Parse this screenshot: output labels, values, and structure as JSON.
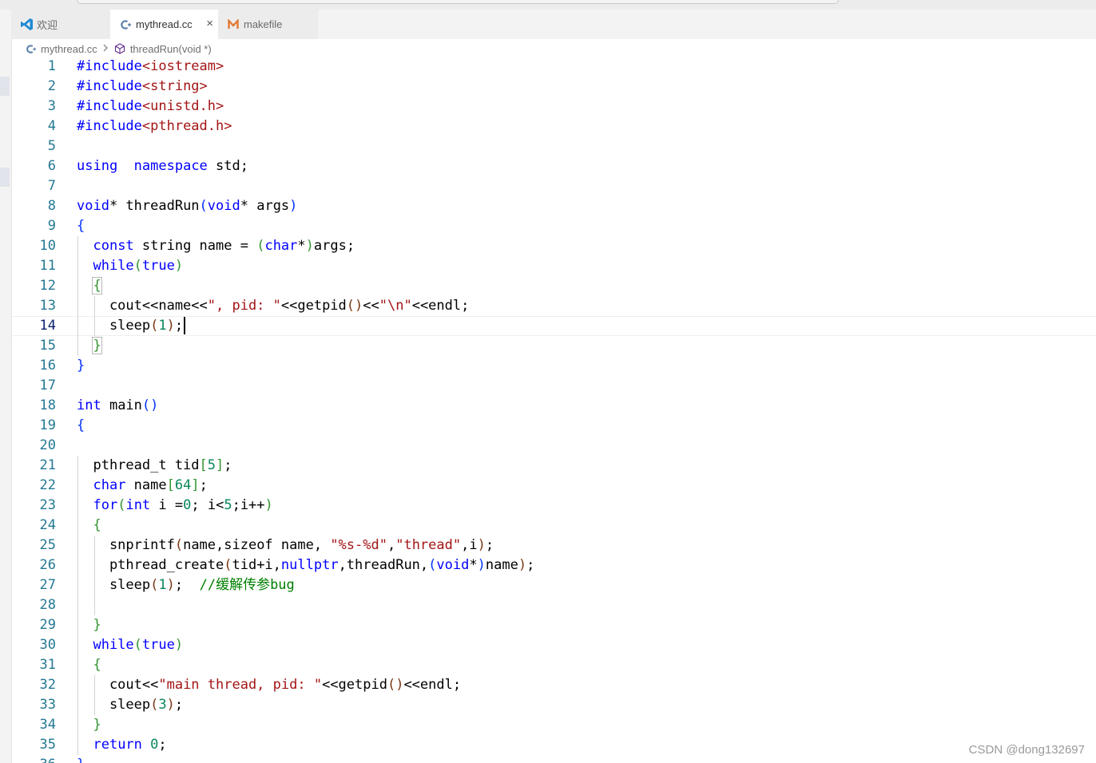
{
  "tabs": [
    {
      "label": "欢迎",
      "icon": "vscode-logo-icon"
    },
    {
      "label": "mythread.cc",
      "icon": "cpp-file-icon",
      "close_glyph": "×"
    },
    {
      "label": "makefile",
      "icon": "makefile-m-icon"
    }
  ],
  "breadcrumb": {
    "file": "mythread.cc",
    "symbol": "threadRun(void *)"
  },
  "editor": {
    "current_line": 14,
    "lines": [
      [
        [
          "pp",
          "#include"
        ],
        [
          "s",
          "<iostream>"
        ]
      ],
      [
        [
          "pp",
          "#include"
        ],
        [
          "s",
          "<string>"
        ]
      ],
      [
        [
          "pp",
          "#include"
        ],
        [
          "s",
          "<unistd.h>"
        ]
      ],
      [
        [
          "pp",
          "#include"
        ],
        [
          "s",
          "<pthread.h>"
        ]
      ],
      [],
      [
        [
          "k",
          "using"
        ],
        [
          "",
          "  "
        ],
        [
          "k",
          "namespace"
        ],
        [
          "",
          " std;"
        ]
      ],
      [],
      [
        [
          "k",
          "void"
        ],
        [
          "",
          "* threadRun"
        ],
        [
          "b1",
          "("
        ],
        [
          "k",
          "void"
        ],
        [
          "",
          "* args"
        ],
        [
          "b1",
          ")"
        ]
      ],
      [
        [
          "b1",
          "{"
        ]
      ],
      [
        [
          "",
          "  "
        ],
        [
          "k",
          "const"
        ],
        [
          "",
          " string name = "
        ],
        [
          "b2",
          "("
        ],
        [
          "k",
          "char"
        ],
        [
          "",
          "*"
        ],
        [
          "b2",
          ")"
        ],
        [
          "",
          "args;"
        ]
      ],
      [
        [
          "",
          "  "
        ],
        [
          "k",
          "while"
        ],
        [
          "b2",
          "("
        ],
        [
          "k",
          "true"
        ],
        [
          "b2",
          ")"
        ]
      ],
      [
        [
          "",
          "  "
        ],
        [
          "b2x",
          "{"
        ]
      ],
      [
        [
          "",
          "    cout<<name<<"
        ],
        [
          "s",
          "\", pid: \""
        ],
        [
          "",
          "<<getpid"
        ],
        [
          "b3",
          "()"
        ],
        [
          "",
          "<<"
        ],
        [
          "s",
          "\"\\n\""
        ],
        [
          "",
          "<<endl;"
        ]
      ],
      [
        [
          "",
          "    sleep"
        ],
        [
          "b3",
          "("
        ],
        [
          "n",
          "1"
        ],
        [
          "b3",
          ")"
        ],
        [
          "",
          ";"
        ]
      ],
      [
        [
          "",
          "  "
        ],
        [
          "b2x",
          "}"
        ]
      ],
      [
        [
          "b1",
          "}"
        ]
      ],
      [],
      [
        [
          "k",
          "int"
        ],
        [
          "",
          " main"
        ],
        [
          "b1",
          "()"
        ]
      ],
      [
        [
          "b1",
          "{"
        ]
      ],
      [],
      [
        [
          "",
          "  pthread_t tid"
        ],
        [
          "b2",
          "["
        ],
        [
          "n",
          "5"
        ],
        [
          "b2",
          "]"
        ],
        [
          "",
          ";"
        ]
      ],
      [
        [
          "",
          "  "
        ],
        [
          "k",
          "char"
        ],
        [
          "",
          " name"
        ],
        [
          "b2",
          "["
        ],
        [
          "n",
          "64"
        ],
        [
          "b2",
          "]"
        ],
        [
          "",
          ";"
        ]
      ],
      [
        [
          "",
          "  "
        ],
        [
          "k",
          "for"
        ],
        [
          "b2",
          "("
        ],
        [
          "k",
          "int"
        ],
        [
          "",
          " i ="
        ],
        [
          "n",
          "0"
        ],
        [
          "",
          "; i<"
        ],
        [
          "n",
          "5"
        ],
        [
          "",
          ";i++"
        ],
        [
          "b2",
          ")"
        ]
      ],
      [
        [
          "",
          "  "
        ],
        [
          "b2",
          "{"
        ]
      ],
      [
        [
          "",
          "    snprintf"
        ],
        [
          "b3",
          "("
        ],
        [
          "",
          "name,sizeof name, "
        ],
        [
          "s",
          "\"%s-%d\""
        ],
        [
          "",
          ","
        ],
        [
          "s",
          "\"thread\""
        ],
        [
          "",
          ",i"
        ],
        [
          "b3",
          ")"
        ],
        [
          "",
          ";"
        ]
      ],
      [
        [
          "",
          "    pthread_create"
        ],
        [
          "b3",
          "("
        ],
        [
          "",
          "tid+i,"
        ],
        [
          "k",
          "nullptr"
        ],
        [
          "",
          ",threadRun,"
        ],
        [
          "b1",
          "("
        ],
        [
          "k",
          "void"
        ],
        [
          "",
          "*"
        ],
        [
          "b1",
          ")"
        ],
        [
          "",
          "name"
        ],
        [
          "b3",
          ")"
        ],
        [
          "",
          ";"
        ]
      ],
      [
        [
          "",
          "    sleep"
        ],
        [
          "b3",
          "("
        ],
        [
          "n",
          "1"
        ],
        [
          "b3",
          ")"
        ],
        [
          "",
          ";  "
        ],
        [
          "c",
          "//缓解传参bug"
        ]
      ],
      [],
      [
        [
          "",
          "  "
        ],
        [
          "b2",
          "}"
        ]
      ],
      [
        [
          "",
          "  "
        ],
        [
          "k",
          "while"
        ],
        [
          "b2",
          "("
        ],
        [
          "k",
          "true"
        ],
        [
          "b2",
          ")"
        ]
      ],
      [
        [
          "",
          "  "
        ],
        [
          "b2",
          "{"
        ]
      ],
      [
        [
          "",
          "    cout<<"
        ],
        [
          "s",
          "\"main thread, pid: \""
        ],
        [
          "",
          "<<getpid"
        ],
        [
          "b3",
          "()"
        ],
        [
          "",
          "<<endl;"
        ]
      ],
      [
        [
          "",
          "    sleep"
        ],
        [
          "b3",
          "("
        ],
        [
          "n",
          "3"
        ],
        [
          "b3",
          ")"
        ],
        [
          "",
          ";"
        ]
      ],
      [
        [
          "",
          "  "
        ],
        [
          "b2",
          "}"
        ]
      ],
      [
        [
          "",
          "  "
        ],
        [
          "k",
          "return"
        ],
        [
          "",
          " "
        ],
        [
          "n",
          "0"
        ],
        [
          "",
          ";"
        ]
      ],
      [
        [
          "b1",
          "}"
        ]
      ]
    ]
  },
  "watermark": "CSDN @dong132697",
  "colors": {
    "keyword": "#0000ff",
    "string": "#a31515",
    "number": "#098658",
    "comment": "#008000",
    "line_number": "#237893"
  }
}
